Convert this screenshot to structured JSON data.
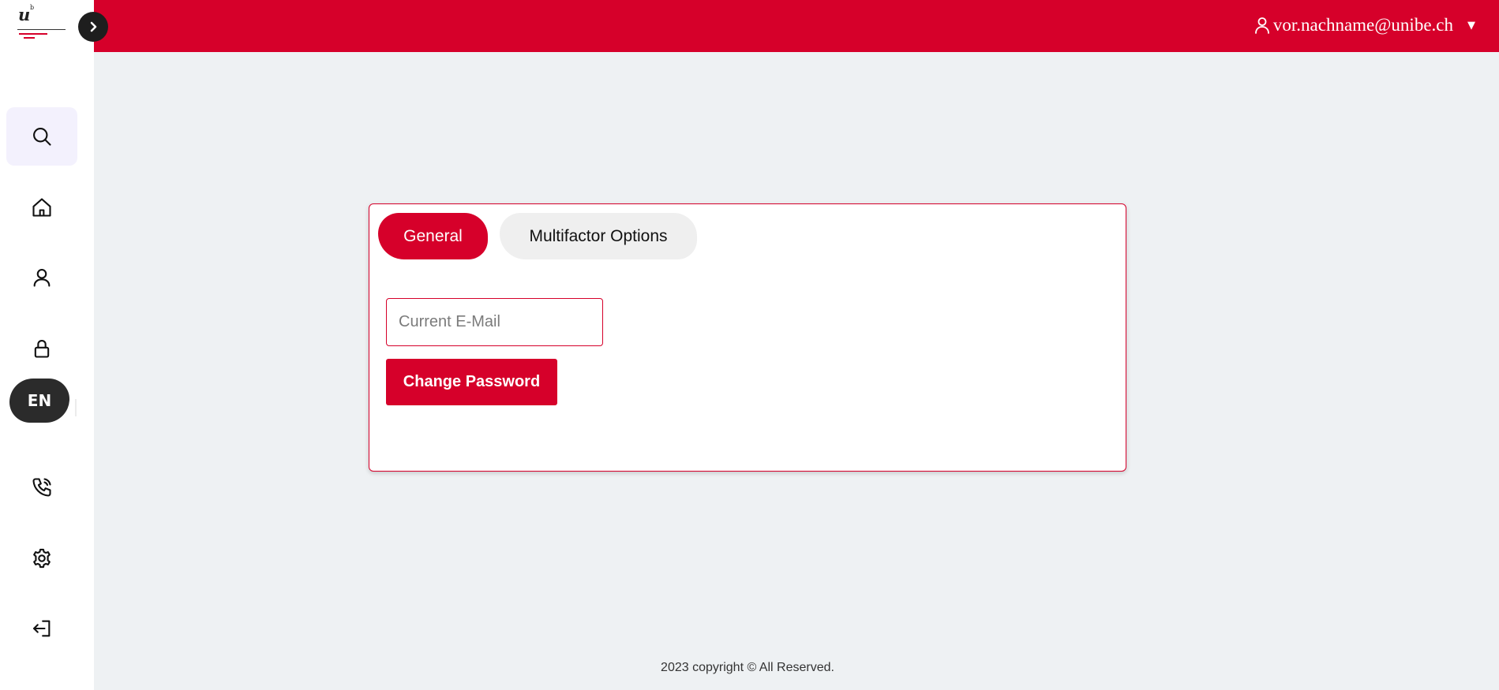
{
  "brand": {
    "logo_letter": "u",
    "logo_superscript": "b",
    "accent_color": "#d6002a"
  },
  "sidebar": {
    "toggle_icon": "chevron-right-icon",
    "items": [
      {
        "name": "search",
        "icon": "search-icon",
        "active": true
      },
      {
        "name": "home",
        "icon": "home-icon",
        "active": false
      },
      {
        "name": "profile",
        "icon": "user-icon",
        "active": false
      },
      {
        "name": "security",
        "icon": "lock-icon",
        "active": false
      },
      {
        "name": "contact",
        "icon": "phone-icon",
        "active": false
      },
      {
        "name": "settings",
        "icon": "gear-icon",
        "active": false
      },
      {
        "name": "logout",
        "icon": "logout-icon",
        "active": false
      }
    ],
    "language_label": "EN"
  },
  "header": {
    "user_email": "vor.nachname@unibe.ch",
    "user_icon": "user-icon",
    "dropdown_caret": "▼"
  },
  "card": {
    "tabs": [
      {
        "label": "General",
        "active": true
      },
      {
        "label": "Multifactor Options",
        "active": false
      }
    ],
    "email_input": {
      "placeholder": "Current E-Mail",
      "value": ""
    },
    "change_password_label": "Change Password"
  },
  "footer": {
    "text": "2023 copyright © All Reserved."
  }
}
